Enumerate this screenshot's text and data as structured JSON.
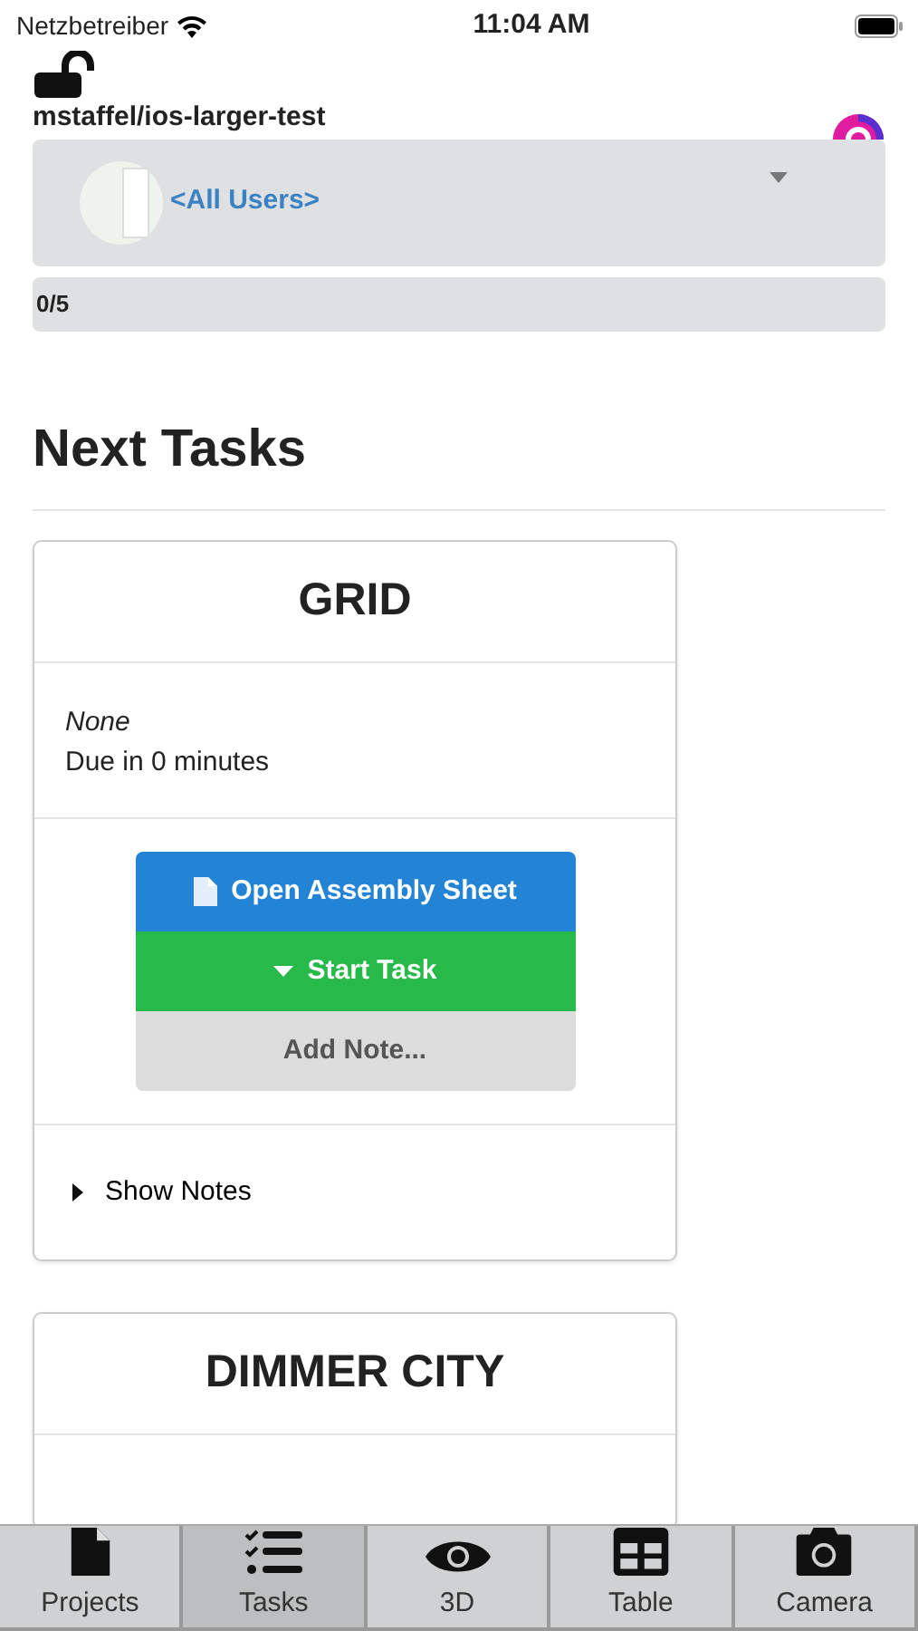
{
  "status_bar": {
    "carrier": "Netzbetreiber",
    "time": "11:04 AM"
  },
  "header": {
    "locked": false,
    "project": "mstaffel/ios-larger-test"
  },
  "user_filter": {
    "value": "<All Users>"
  },
  "progress": {
    "text": "0/5"
  },
  "section_title": "Next Tasks",
  "tasks": [
    {
      "title": "GRID",
      "assignee": "None",
      "due": "Due in 0 minutes",
      "actions": [
        {
          "kind": "primary",
          "label": "Open Assembly Sheet"
        },
        {
          "kind": "success",
          "label": "Start Task"
        },
        {
          "kind": "secondary",
          "label": "Add Note..."
        }
      ],
      "notes_toggle": {
        "label": "Show Notes",
        "expanded": false
      }
    },
    {
      "title": "DIMMER CITY"
    }
  ],
  "tab_bar": [
    {
      "label": "Projects",
      "kind": "file",
      "selected": false
    },
    {
      "label": "Tasks",
      "kind": "tasks",
      "selected": true
    },
    {
      "label": "3D",
      "kind": "eye",
      "selected": false
    },
    {
      "label": "Table",
      "kind": "table",
      "selected": false
    },
    {
      "label": "Camera",
      "kind": "camera",
      "selected": false
    }
  ]
}
